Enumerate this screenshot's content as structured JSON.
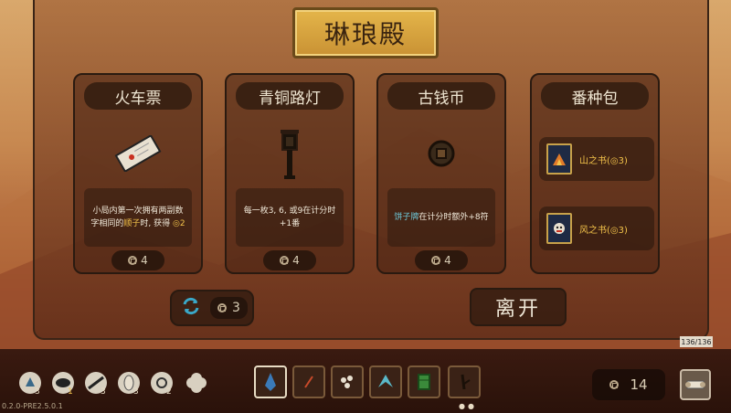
{
  "shop": {
    "title": "琳琅殿"
  },
  "cards": [
    {
      "name": "火车票",
      "desc_parts": [
        "小局内第一次拥有两副数字相同的",
        "顺子",
        "时, 获得",
        "◎2"
      ],
      "price": "4"
    },
    {
      "name": "青铜路灯",
      "desc_parts": [
        "每一枚3, 6, 或9在计分时+1番"
      ],
      "price": "4"
    },
    {
      "name": "古钱币",
      "desc_parts": [
        "饼子牌",
        "在计分时额外+8符"
      ],
      "price": "4"
    }
  ],
  "pack": {
    "name": "番种包",
    "items": [
      {
        "label": "山之书(◎3)"
      },
      {
        "label": "风之书(◎3)"
      }
    ]
  },
  "refresh": {
    "cost": "3"
  },
  "leave_label": "离开",
  "deck_count": "136/136",
  "charms": [
    {
      "count": "3"
    },
    {
      "count": "1"
    },
    {
      "count": "3"
    },
    {
      "count": "3"
    },
    {
      "count": "2"
    },
    {
      "count": ""
    }
  ],
  "money": "14",
  "version": "0.2.0-PRE2.5.0.1",
  "colors": {
    "gold": "#e4b54a",
    "highlight_yellow": "#f2c24a",
    "highlight_blue": "#6ec8d8",
    "refresh_teal": "#3aa8c8"
  },
  "icons": {
    "card_1": "train-ticket-icon",
    "card_2": "bronze-lamp-icon",
    "card_3": "ancient-coin-icon",
    "refresh": "refresh-icon",
    "menu": "scroll-icon"
  }
}
